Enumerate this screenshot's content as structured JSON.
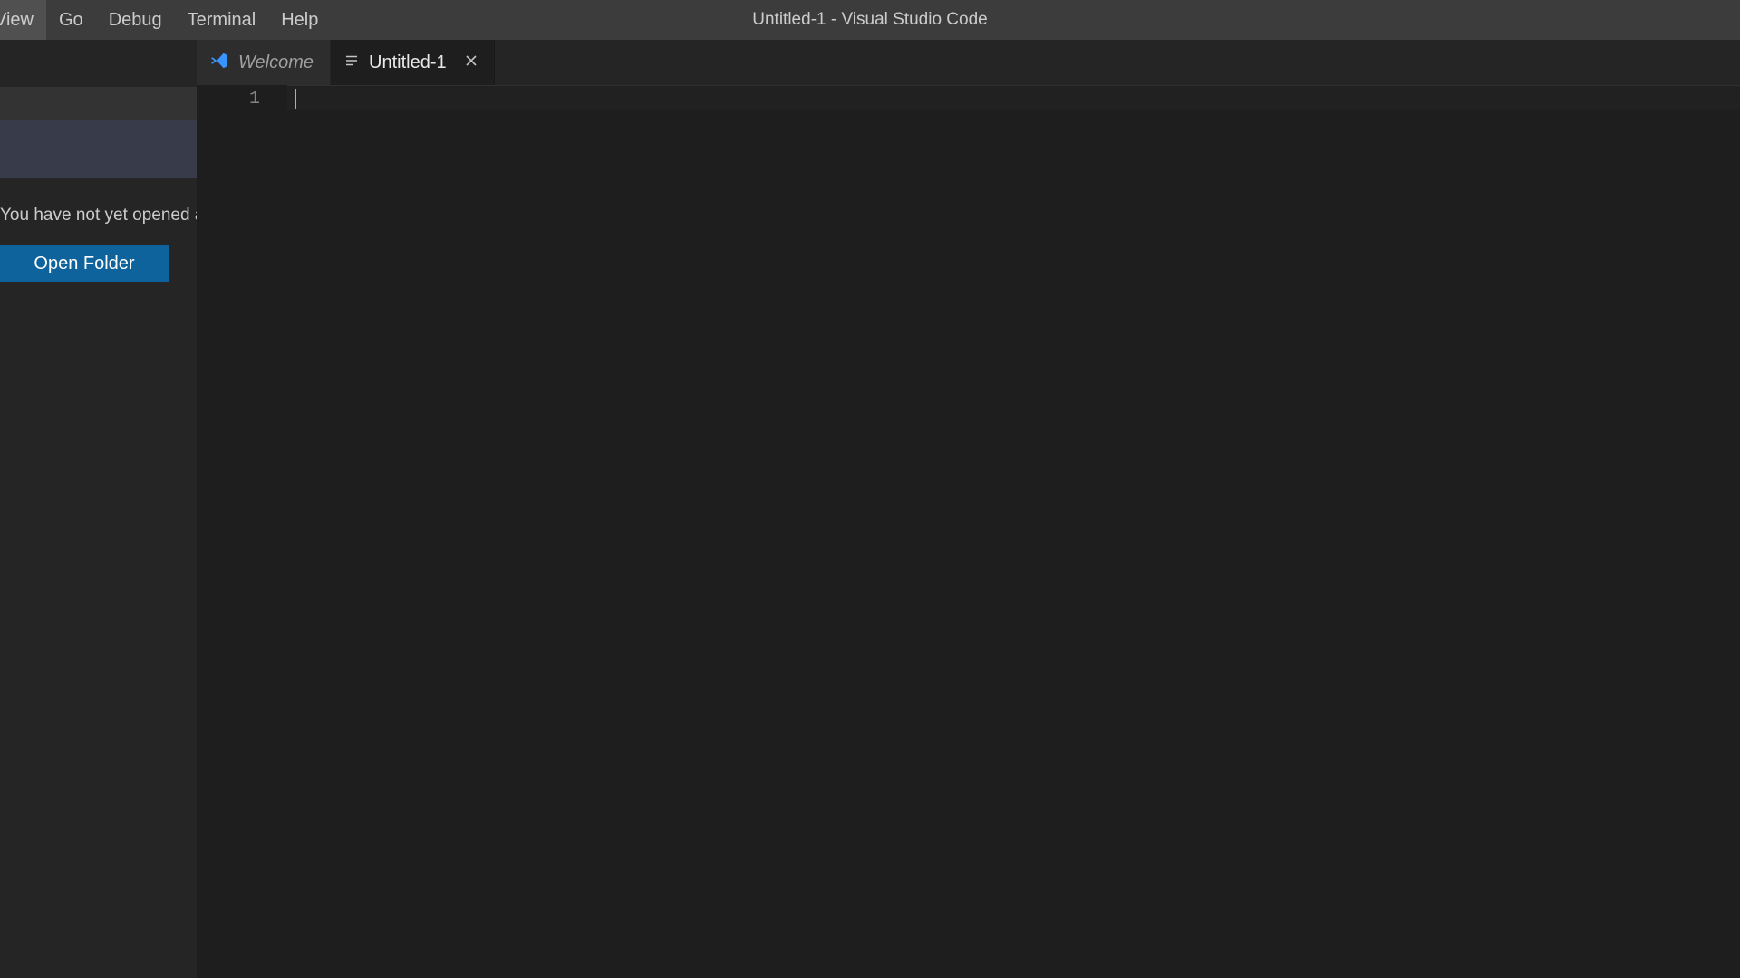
{
  "titlebar": {
    "title": "Untitled-1 - Visual Studio Code"
  },
  "menu": {
    "view": "View",
    "go": "Go",
    "debug": "Debug",
    "terminal": "Terminal",
    "help": "Help"
  },
  "sidebar": {
    "message": "You have not yet opened a folder.",
    "open_folder_label": "Open Folder"
  },
  "tabs": {
    "welcome": {
      "label": "Welcome"
    },
    "untitled": {
      "label": "Untitled-1"
    }
  },
  "editor": {
    "line_number": "1"
  }
}
